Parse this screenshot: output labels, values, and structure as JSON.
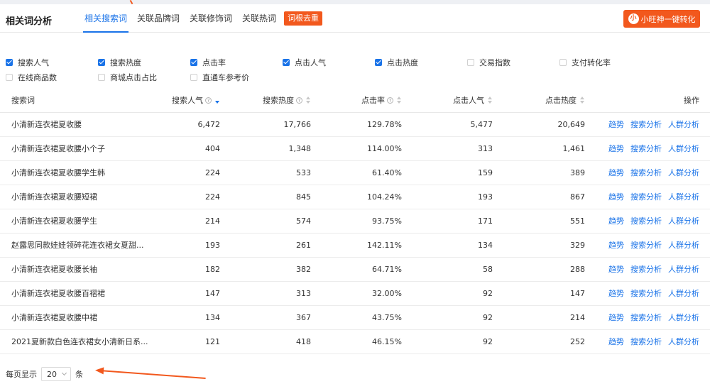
{
  "header": {
    "title": "相关词分析",
    "tabs": [
      "相关搜索词",
      "关联品牌词",
      "关联修饰词",
      "关联热词"
    ],
    "dedup_label": "词根去重",
    "convert_label": "小旺神一键转化",
    "convert_icon": "小"
  },
  "filters": [
    [
      {
        "label": "搜索人气",
        "checked": true
      },
      {
        "label": "搜索热度",
        "checked": true
      },
      {
        "label": "点击率",
        "checked": true
      },
      {
        "label": "点击人气",
        "checked": true
      },
      {
        "label": "点击热度",
        "checked": true
      },
      {
        "label": "交易指数",
        "checked": false
      },
      {
        "label": "支付转化率",
        "checked": false
      }
    ],
    [
      {
        "label": "在线商品数",
        "checked": false
      },
      {
        "label": "商城点击占比",
        "checked": false
      },
      {
        "label": "直通车参考价",
        "checked": false
      }
    ]
  ],
  "table": {
    "columns": [
      "搜索词",
      "搜索人气",
      "搜索热度",
      "点击率",
      "点击人气",
      "点击热度",
      "操作"
    ],
    "actions": [
      "趋势",
      "搜索分析",
      "人群分析"
    ],
    "rows": [
      [
        "小清新连衣裙夏收腰",
        "6,472",
        "17,766",
        "129.78%",
        "5,477",
        "20,649"
      ],
      [
        "小清新连衣裙夏收腰小个子",
        "404",
        "1,348",
        "114.00%",
        "313",
        "1,461"
      ],
      [
        "小清新连衣裙夏收腰学生韩",
        "224",
        "533",
        "61.40%",
        "159",
        "389"
      ],
      [
        "小清新连衣裙夏收腰短裙",
        "224",
        "845",
        "104.24%",
        "193",
        "867"
      ],
      [
        "小清新连衣裙夏收腰学生",
        "214",
        "574",
        "93.75%",
        "171",
        "551"
      ],
      [
        "赵露思同款娃娃领碎花连衣裙女夏甜...",
        "193",
        "261",
        "142.11%",
        "134",
        "329"
      ],
      [
        "小清新连衣裙夏收腰长袖",
        "182",
        "382",
        "64.71%",
        "58",
        "288"
      ],
      [
        "小清新连衣裙夏收腰百褶裙",
        "147",
        "313",
        "32.00%",
        "92",
        "147"
      ],
      [
        "小清新连衣裙夏收腰中裙",
        "134",
        "367",
        "43.75%",
        "92",
        "214"
      ],
      [
        "2021夏新款白色连衣裙女小清新日系...",
        "121",
        "418",
        "46.15%",
        "92",
        "252"
      ]
    ]
  },
  "pager": {
    "prefix": "每页显示",
    "page_size": "20",
    "suffix": "条"
  },
  "colors": {
    "accent": "#1a73e8",
    "orange": "#f2581d"
  }
}
